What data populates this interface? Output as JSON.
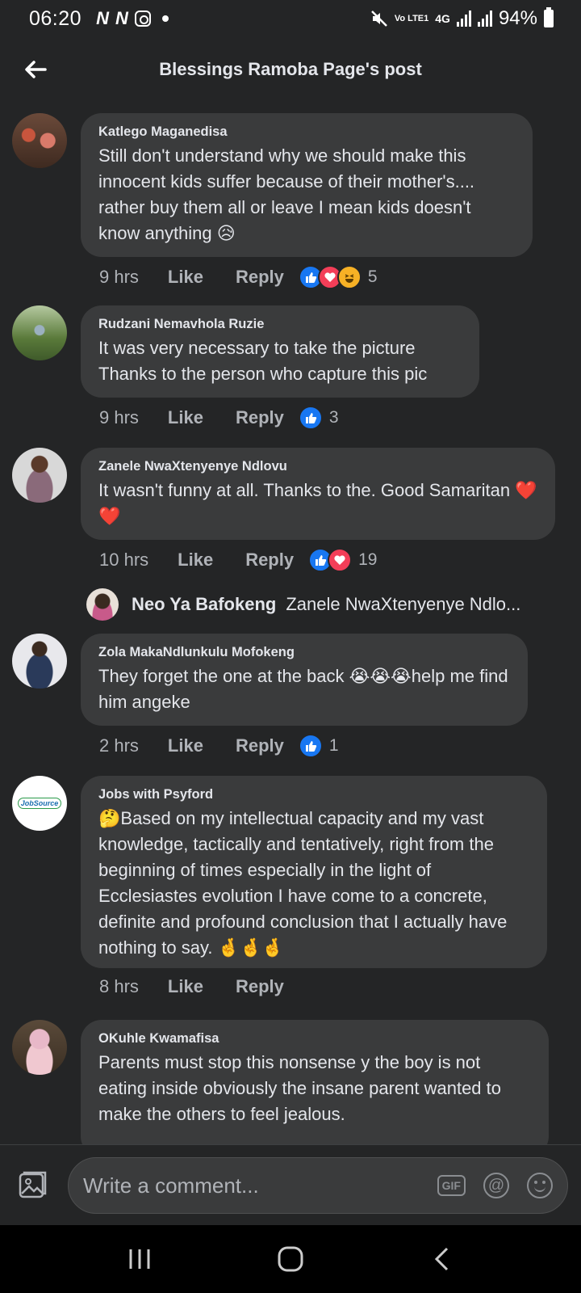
{
  "status_bar": {
    "time": "06:20",
    "network": "4G",
    "volte": "Vo LTE1",
    "battery": "94%"
  },
  "header": {
    "title": "Blessings Ramoba Page's post"
  },
  "comments": [
    {
      "author": "Katlego Maganedisa",
      "text": "Still don't understand why we should make this innocent kids suffer because of their mother's.... rather buy them all or leave I mean kids doesn't know anything 😥",
      "time": "9 hrs",
      "like": "Like",
      "reply": "Reply",
      "reactions": [
        "like",
        "love",
        "haha"
      ],
      "reaction_count": "5"
    },
    {
      "author": "Rudzani Nemavhola Ruzie",
      "text": "It was very necessary to take the picture Thanks to the person who capture this pic",
      "time": "9 hrs",
      "like": "Like",
      "reply": "Reply",
      "reactions": [
        "like"
      ],
      "reaction_count": "3"
    },
    {
      "author": "Zanele NwaXtenyenye Ndlovu",
      "text": "It wasn't funny at all. Thanks to the. Good Samaritan ❤️❤️",
      "time": "10 hrs",
      "like": "Like",
      "reply": "Reply",
      "reactions": [
        "like",
        "love"
      ],
      "reaction_count": "19",
      "reply_preview": {
        "name": "Neo Ya Bafokeng",
        "text": "Zanele NwaXtenyenye Ndlo..."
      }
    },
    {
      "author": "Zola MakaNdlunkulu Mofokeng",
      "text": "They forget the one at the back 😭😭😭help me find him angeke",
      "time": "2 hrs",
      "like": "Like",
      "reply": "Reply",
      "reactions": [
        "like"
      ],
      "reaction_count": "1"
    },
    {
      "author": "Jobs with Psyford",
      "text": "🤔Based on my intellectual capacity and my vast knowledge, tactically and tentatively, right from the beginning of times especially in the light of Ecclesiastes evolution I have come to a concrete, definite and profound conclusion that I actually have nothing to say. 🤞🤞🤞",
      "time": "8 hrs",
      "like": "Like",
      "reply": "Reply",
      "avatar_text": "JobSource"
    },
    {
      "author": "OKuhle Kwamafisa",
      "text": "Parents must stop this nonsense y the boy is not eating inside obviously the insane parent wanted to make the others to feel jealous."
    }
  ],
  "composer": {
    "placeholder": "Write a comment...",
    "gif_label": "GIF",
    "at_label": "@"
  },
  "colors": {
    "background": "#242526",
    "bubble": "#3a3b3c",
    "like_blue": "#1877f2",
    "love_red": "#f33e58",
    "haha_yellow": "#f7b125"
  }
}
